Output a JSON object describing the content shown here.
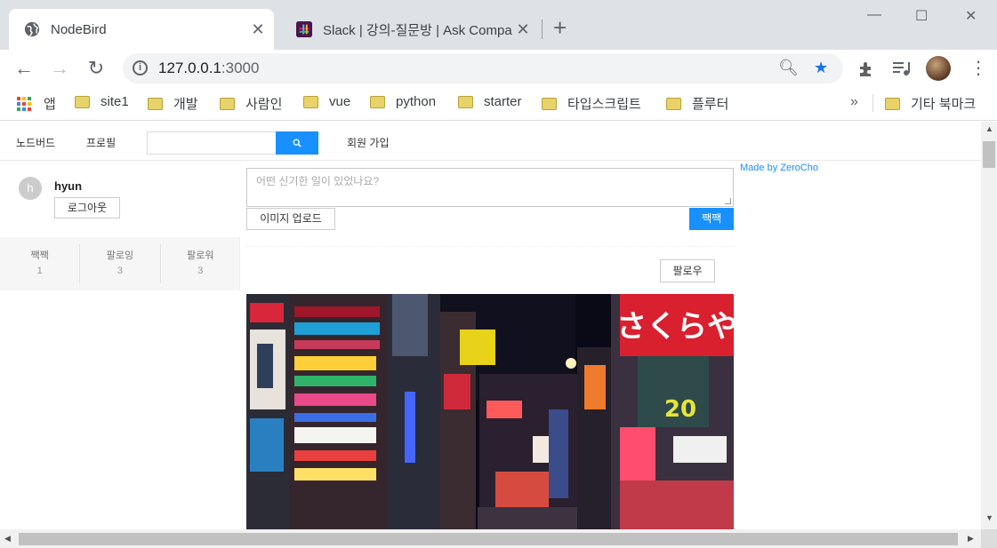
{
  "browser": {
    "tabs": [
      {
        "title": "NodeBird",
        "active": true,
        "icon": "globe-icon"
      },
      {
        "title": "Slack | 강의-질문방 | Ask Compa",
        "active": false,
        "icon": "slack-icon"
      }
    ],
    "url": {
      "host": "127.0.0.1",
      "port": ":3000"
    },
    "bookmarks": [
      {
        "label": "앱",
        "icon": "apps-grid-icon"
      },
      {
        "label": "site1",
        "icon": "folder-icon"
      },
      {
        "label": "개발",
        "icon": "folder-icon"
      },
      {
        "label": "사람인",
        "icon": "folder-icon"
      },
      {
        "label": "vue",
        "icon": "folder-icon"
      },
      {
        "label": "python",
        "icon": "folder-icon"
      },
      {
        "label": "starter",
        "icon": "folder-icon"
      },
      {
        "label": "타입스크립트",
        "icon": "folder-icon"
      },
      {
        "label": "플루터",
        "icon": "folder-icon"
      },
      {
        "label": "기타 북마크",
        "icon": "folder-icon"
      }
    ],
    "bookmarks_overflow": "»",
    "colors": {
      "accent": "#1a73e8",
      "tabstrip": "#dee1e6"
    }
  },
  "page": {
    "menu": {
      "home": "노드버드",
      "profile": "프로필",
      "signup": "회원 가입",
      "search_button": "🔍"
    },
    "user": {
      "avatar_letter": "h",
      "nickname": "hyun",
      "logout": "로그아웃",
      "stats": [
        {
          "label": "짹짹",
          "value": "1"
        },
        {
          "label": "팔로잉",
          "value": "3"
        },
        {
          "label": "팔로워",
          "value": "3"
        }
      ]
    },
    "post_form": {
      "placeholder": "어떤 신기한 일이 있었나요?",
      "upload": "이미지 업로드",
      "submit": "짹짹"
    },
    "post": {
      "follow": "팔로우",
      "image_sign": "さくらや",
      "image_number": "20"
    },
    "footer_link": "Made by ZeroCho",
    "colors": {
      "primary": "#1890ff"
    }
  }
}
